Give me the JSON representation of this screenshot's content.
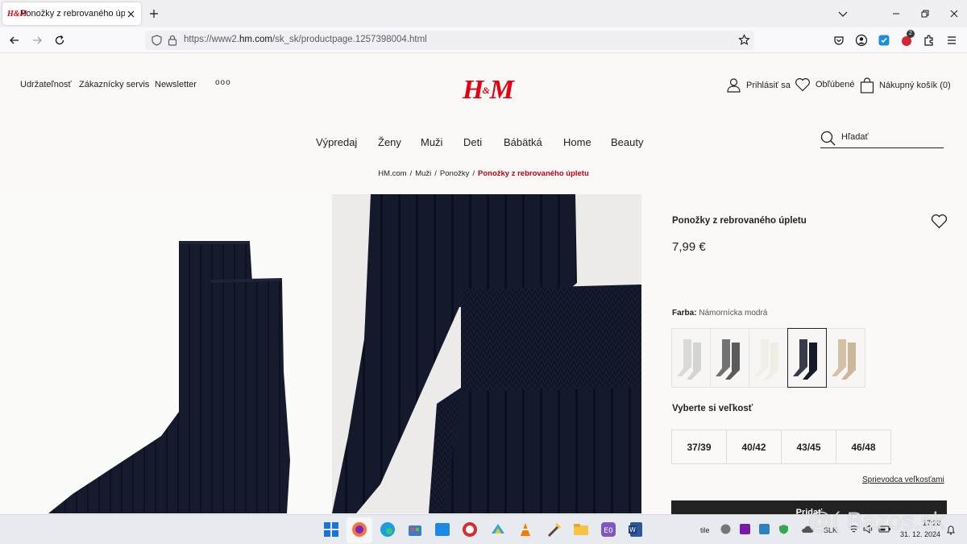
{
  "browser": {
    "tab_title": "Ponožky z rebrovaného úpletu",
    "tab_favicon": "H&M",
    "url_prefix": "https://www2.",
    "url_domain": "hm.com",
    "url_path": "/sk_sk/productpage.1257398004.html",
    "notification_count": "2"
  },
  "header": {
    "util_links": [
      "Udržateľnosť",
      "Zákaznícky servis",
      "Newsletter"
    ],
    "more": "ooo",
    "logo": "H&M",
    "sign_in": "Prihlásiť sa",
    "favorites": "Obľúbené",
    "cart": "Nákupný košík (0)"
  },
  "nav": {
    "items": [
      "Výpredaj",
      "Ženy",
      "Muži",
      "Deti",
      "Bábätká",
      "Home",
      "Beauty"
    ],
    "search_placeholder": "Hľadať"
  },
  "breadcrumb": [
    "HM.com",
    "Muži",
    "Ponožky",
    "Ponožky z rebrovaného úpletu"
  ],
  "product": {
    "title": "Ponožky z rebrovaného úpletu",
    "price": "7,99 €",
    "color_label": "Farba:",
    "color_value": "Námornícka modrá",
    "swatches": [
      {
        "color": "#d4d5d3"
      },
      {
        "color": "#5b5b5b"
      },
      {
        "color": "#eeeee6"
      },
      {
        "color": "#161a2b"
      },
      {
        "color": "#cdb79a"
      }
    ],
    "selected_swatch": 3,
    "size_label": "Vyberte si veľkosť",
    "sizes": [
      "37/39",
      "40/42",
      "43/45",
      "46/48"
    ],
    "size_guide": "Sprievodca veľkosťami",
    "add_to_cart": "Pridať"
  },
  "colors": {
    "brand_red": "#e50010",
    "sock_navy": "#151a2d"
  },
  "taskbar": {
    "language": "SLK",
    "tile_label": "tile",
    "time": "17:28",
    "date": "31. 12. 2024"
  },
  "watermark": "@( Bazos.sk"
}
